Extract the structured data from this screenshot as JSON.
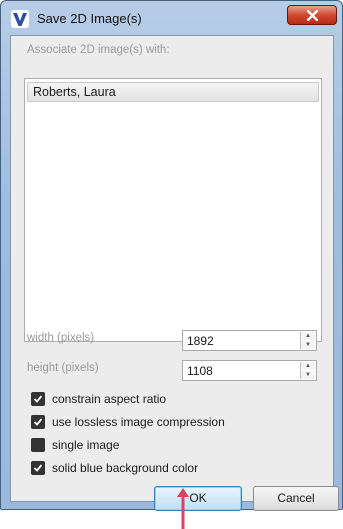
{
  "window": {
    "title": "Save 2D Image(s)",
    "close_label": "x"
  },
  "associate": {
    "label": "Associate 2D image(s) with:",
    "items": [
      "Roberts, Laura"
    ]
  },
  "width": {
    "label": "width (pixels)",
    "value": "1892"
  },
  "height": {
    "label": "height (pixels)",
    "value": "1108"
  },
  "options": [
    {
      "label": "constrain aspect ratio",
      "checked": true
    },
    {
      "label": "use lossless image compression",
      "checked": true
    },
    {
      "label": "single image",
      "checked": false
    },
    {
      "label": "solid blue background color",
      "checked": true
    }
  ],
  "buttons": {
    "ok": "OK",
    "cancel": "Cancel"
  },
  "colors": {
    "app_icon": "#2a4fa3",
    "close": "#c9402a",
    "pointer": "#d9455b"
  }
}
